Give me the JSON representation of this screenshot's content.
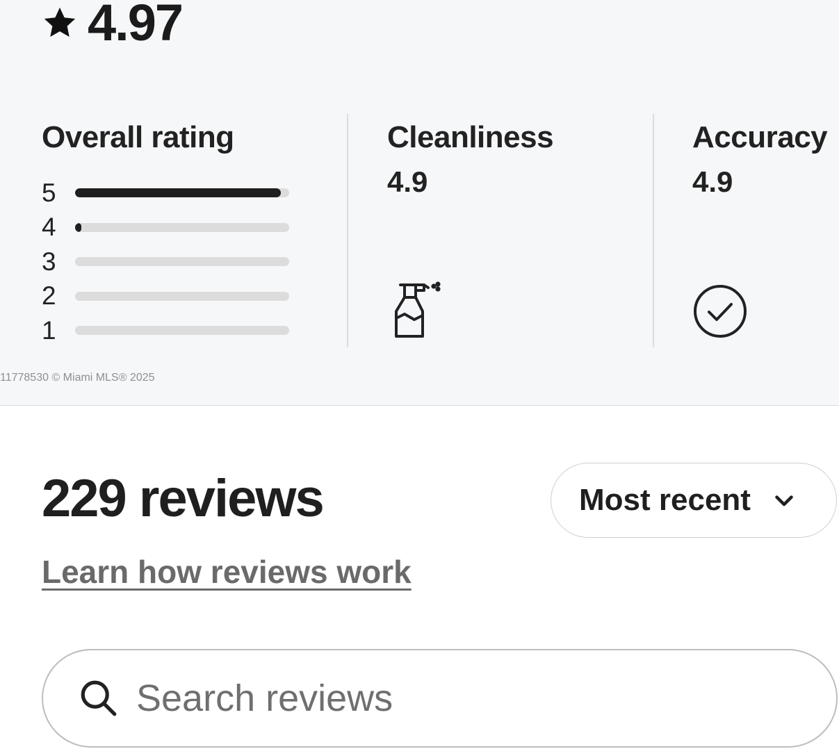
{
  "rating": {
    "score": "4.97",
    "star_icon": "star-icon"
  },
  "overall": {
    "title": "Overall rating",
    "distribution": [
      {
        "label": "5",
        "fraction": 0.96
      },
      {
        "label": "4",
        "fraction": 0.03
      },
      {
        "label": "3",
        "fraction": 0.0
      },
      {
        "label": "2",
        "fraction": 0.0
      },
      {
        "label": "1",
        "fraction": 0.0
      }
    ]
  },
  "categories": [
    {
      "title": "Cleanliness",
      "value": "4.9",
      "icon": "spray-bottle-icon"
    },
    {
      "title": "Accuracy",
      "value": "4.9",
      "icon": "check-circle-icon"
    }
  ],
  "watermark": "11778530 © Miami MLS® 2025",
  "reviews": {
    "count_label": "229 reviews",
    "sort_label": "Most recent",
    "sort_icon": "chevron-down-icon",
    "learn_link": "Learn how reviews work",
    "search_placeholder": "Search reviews",
    "search_value": "",
    "search_icon": "search-icon"
  }
}
